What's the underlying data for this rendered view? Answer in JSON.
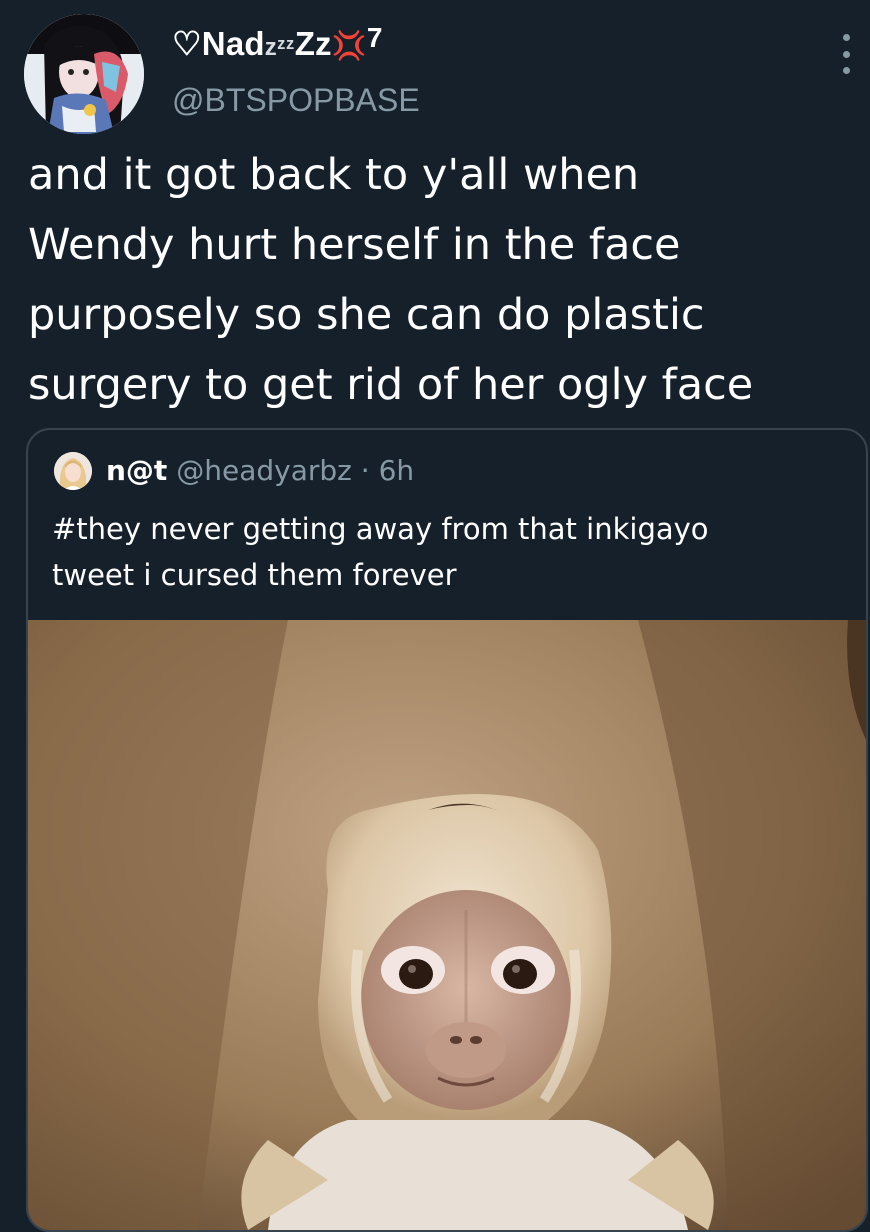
{
  "author": {
    "display_name_prefix": "♡Nad",
    "display_name_zz": "zᶻᶻ",
    "display_name_big_z": "Z",
    "display_name_z": "z",
    "display_name_emoji": "💢",
    "display_name_suffix": "7",
    "handle": "@BTSPOPBASE",
    "avatar_icon": "anime-girl-avatar"
  },
  "more_icon": "more-vertical-icon",
  "tweet_text": "and it got back to y'all when\nWendy hurt herself in the face\npurposely so she can do plastic\nsurgery to get rid of her ogly face",
  "quoted": {
    "name": "n@t",
    "handle": "@headyarbz",
    "separator": "·",
    "time": "6h",
    "text": "#they never getting away from that inkigayo\ntweet i cursed them forever",
    "avatar_icon": "blonde-girl-avatar",
    "photo_icon": "capuchin-monkey-photo"
  },
  "colors": {
    "background": "#15202b",
    "secondary_text": "#8899a6",
    "border": "#38444d"
  }
}
